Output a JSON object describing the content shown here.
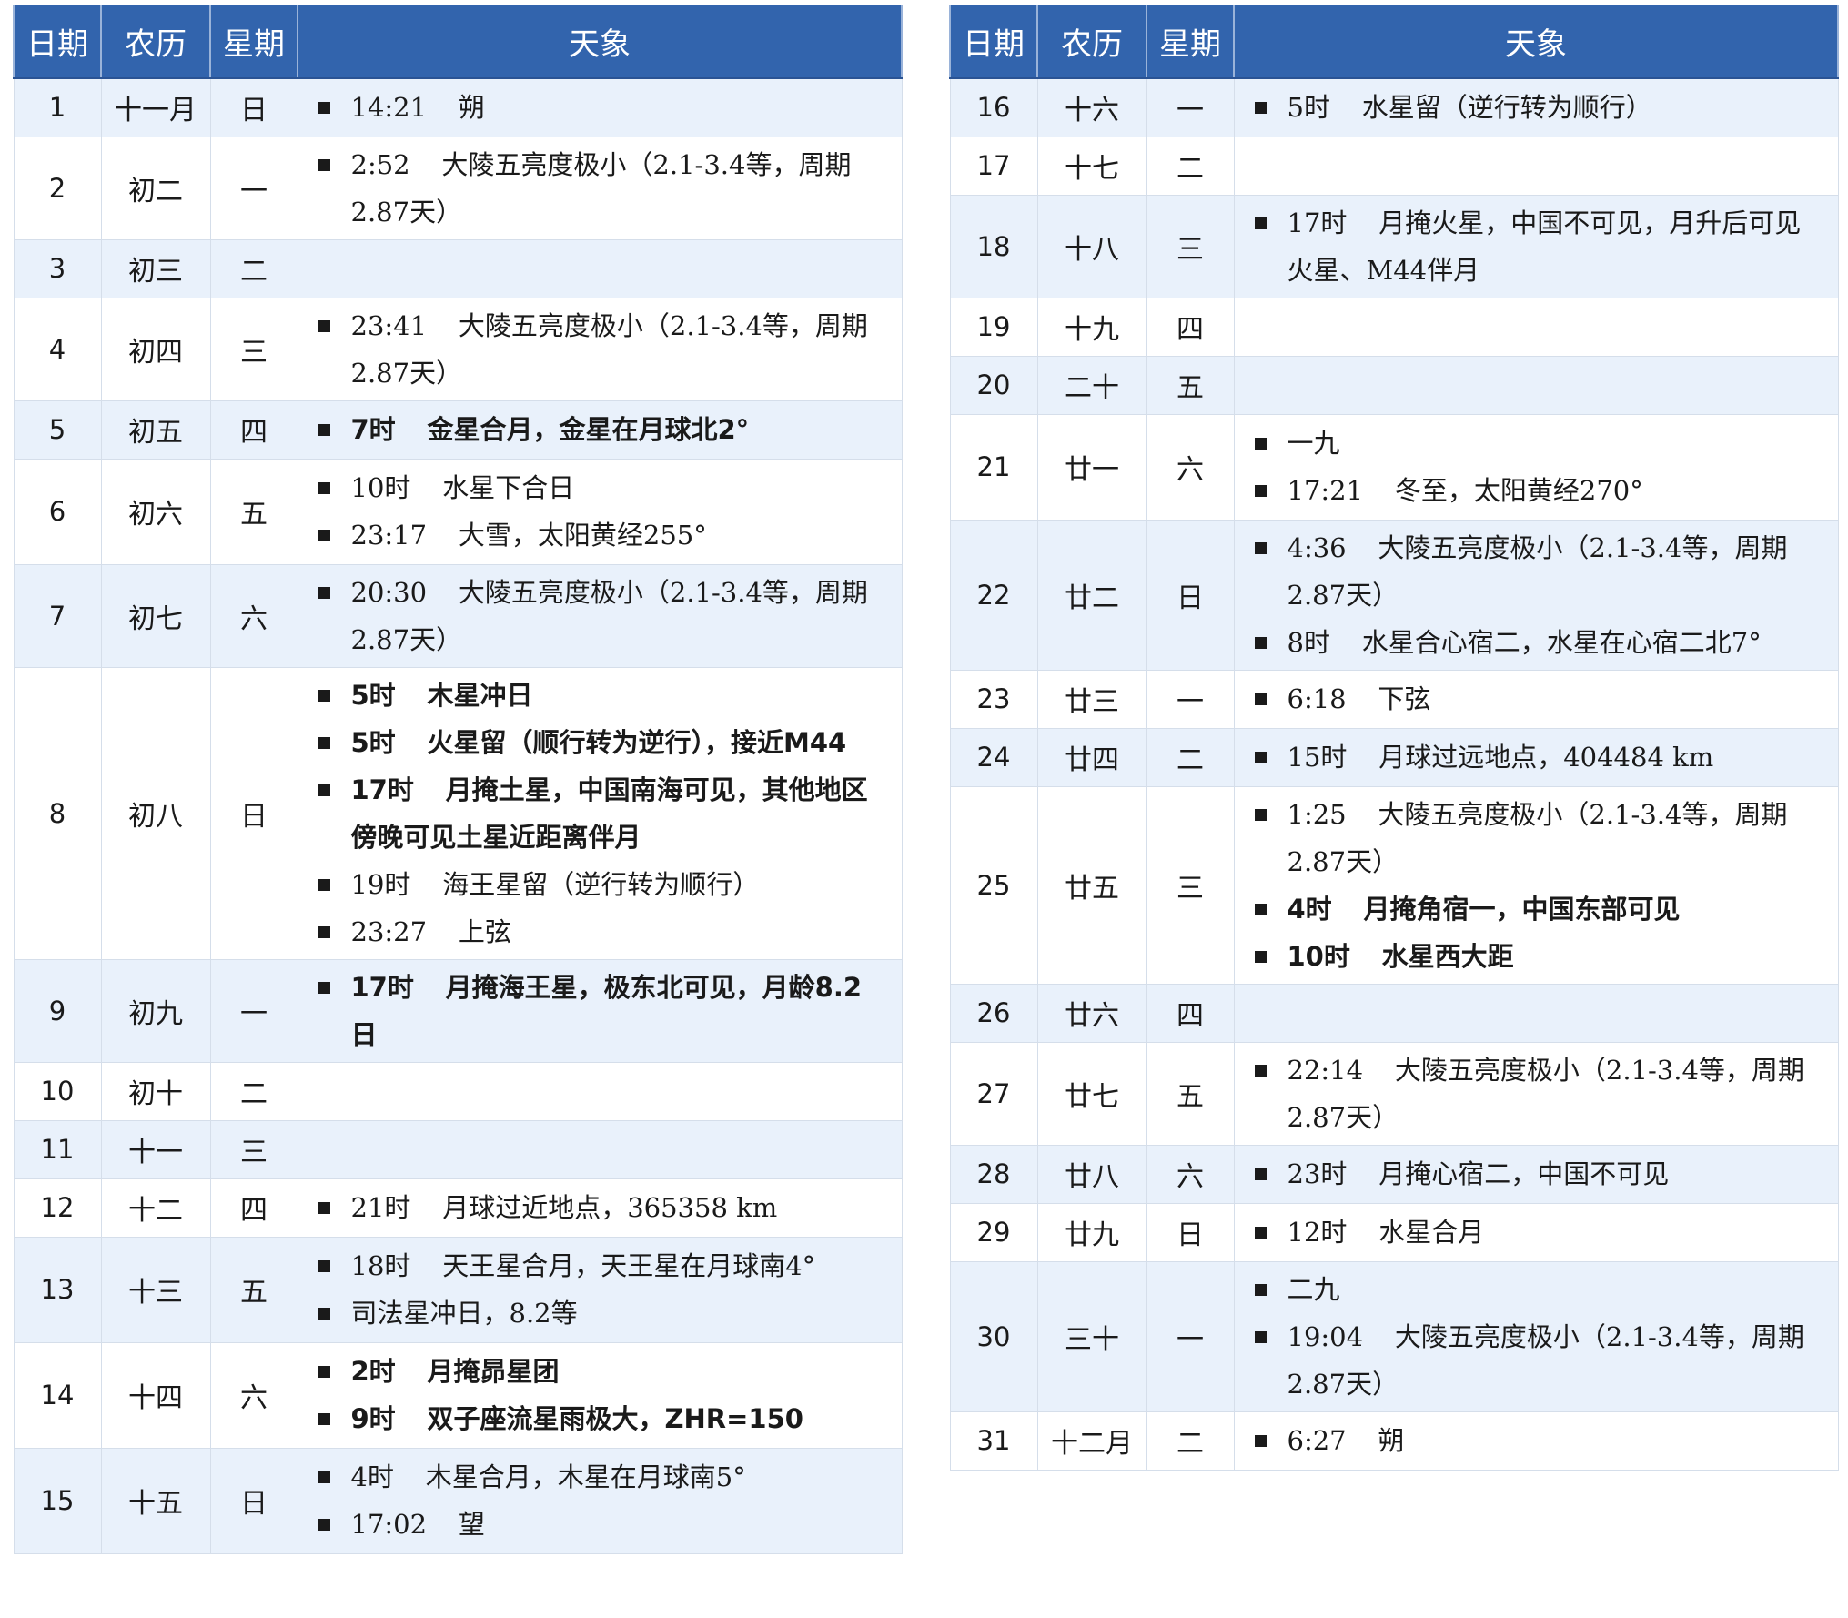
{
  "headers": [
    "日期",
    "农历",
    "星期",
    "天象"
  ],
  "left_rows": [
    {
      "date": "1",
      "lunar": "十一月",
      "weekday": "日",
      "events": [
        {
          "time": "14:21",
          "text": "朔"
        }
      ]
    },
    {
      "date": "2",
      "lunar": "初二",
      "weekday": "一",
      "events": [
        {
          "time": "2:52",
          "text": "大陵五亮度极小（2.1-3.4等，周期2.87天）"
        }
      ]
    },
    {
      "date": "3",
      "lunar": "初三",
      "weekday": "二",
      "events": []
    },
    {
      "date": "4",
      "lunar": "初四",
      "weekday": "三",
      "events": [
        {
          "time": "23:41",
          "text": "大陵五亮度极小（2.1-3.4等，周期2.87天）"
        }
      ]
    },
    {
      "date": "5",
      "lunar": "初五",
      "weekday": "四",
      "events": [
        {
          "time": "7时",
          "text": "金星合月，金星在月球北2°",
          "bold": true
        }
      ]
    },
    {
      "date": "6",
      "lunar": "初六",
      "weekday": "五",
      "events": [
        {
          "time": "10时",
          "text": "水星下合日"
        },
        {
          "time": "23:17",
          "text": "大雪，太阳黄经255°"
        }
      ]
    },
    {
      "date": "7",
      "lunar": "初七",
      "weekday": "六",
      "events": [
        {
          "time": "20:30",
          "text": "大陵五亮度极小（2.1-3.4等，周期2.87天）"
        }
      ]
    },
    {
      "date": "8",
      "lunar": "初八",
      "weekday": "日",
      "events": [
        {
          "time": "5时",
          "text": "木星冲日",
          "bold": true
        },
        {
          "time": "5时",
          "text": "火星留（顺行转为逆行），接近M44",
          "bold": true
        },
        {
          "time": "17时",
          "text": "月掩土星，中国南海可见，其他地区傍晚可见土星近距离伴月",
          "bold": true
        },
        {
          "time": "19时",
          "text": "海王星留（逆行转为顺行）"
        },
        {
          "time": "23:27",
          "text": "上弦"
        }
      ]
    },
    {
      "date": "9",
      "lunar": "初九",
      "weekday": "一",
      "events": [
        {
          "time": "17时",
          "text": "月掩海王星，极东北可见，月龄8.2日",
          "bold": true
        }
      ]
    },
    {
      "date": "10",
      "lunar": "初十",
      "weekday": "二",
      "events": []
    },
    {
      "date": "11",
      "lunar": "十一",
      "weekday": "三",
      "events": []
    },
    {
      "date": "12",
      "lunar": "十二",
      "weekday": "四",
      "events": [
        {
          "time": "21时",
          "text": "月球过近地点，365358 km"
        }
      ]
    },
    {
      "date": "13",
      "lunar": "十三",
      "weekday": "五",
      "events": [
        {
          "time": "18时",
          "text": "天王星合月，天王星在月球南4°"
        },
        {
          "time": "",
          "text": "司法星冲日，8.2等"
        }
      ]
    },
    {
      "date": "14",
      "lunar": "十四",
      "weekday": "六",
      "events": [
        {
          "time": "2时",
          "text": "月掩昴星团",
          "bold": true
        },
        {
          "time": "9时",
          "text": "双子座流星雨极大，ZHR=150",
          "bold": true
        }
      ]
    },
    {
      "date": "15",
      "lunar": "十五",
      "weekday": "日",
      "events": [
        {
          "time": "4时",
          "text": "木星合月，木星在月球南5°"
        },
        {
          "time": "17:02",
          "text": "望"
        }
      ]
    }
  ],
  "right_rows": [
    {
      "date": "16",
      "lunar": "十六",
      "weekday": "一",
      "events": [
        {
          "time": "5时",
          "text": "水星留（逆行转为顺行）"
        }
      ]
    },
    {
      "date": "17",
      "lunar": "十七",
      "weekday": "二",
      "events": []
    },
    {
      "date": "18",
      "lunar": "十八",
      "weekday": "三",
      "events": [
        {
          "time": "17时",
          "text": "月掩火星，中国不可见，月升后可见火星、M44伴月"
        }
      ]
    },
    {
      "date": "19",
      "lunar": "十九",
      "weekday": "四",
      "events": []
    },
    {
      "date": "20",
      "lunar": "二十",
      "weekday": "五",
      "events": []
    },
    {
      "date": "21",
      "lunar": "廿一",
      "weekday": "六",
      "events": [
        {
          "time": "",
          "text": "一九"
        },
        {
          "time": "17:21",
          "text": "冬至，太阳黄经270°"
        }
      ]
    },
    {
      "date": "22",
      "lunar": "廿二",
      "weekday": "日",
      "events": [
        {
          "time": "4:36",
          "text": "大陵五亮度极小（2.1-3.4等，周期2.87天）"
        },
        {
          "time": "8时",
          "text": "水星合心宿二，水星在心宿二北7°"
        }
      ]
    },
    {
      "date": "23",
      "lunar": "廿三",
      "weekday": "一",
      "events": [
        {
          "time": "6:18",
          "text": "下弦"
        }
      ]
    },
    {
      "date": "24",
      "lunar": "廿四",
      "weekday": "二",
      "events": [
        {
          "time": "15时",
          "text": "月球过远地点，404484 km"
        }
      ]
    },
    {
      "date": "25",
      "lunar": "廿五",
      "weekday": "三",
      "events": [
        {
          "time": "1:25",
          "text": "大陵五亮度极小（2.1-3.4等，周期2.87天）"
        },
        {
          "time": "4时",
          "text": "月掩角宿一，中国东部可见",
          "bold": true
        },
        {
          "time": "10时",
          "text": "水星西大距",
          "bold": true
        }
      ]
    },
    {
      "date": "26",
      "lunar": "廿六",
      "weekday": "四",
      "events": []
    },
    {
      "date": "27",
      "lunar": "廿七",
      "weekday": "五",
      "events": [
        {
          "time": "22:14",
          "text": "大陵五亮度极小（2.1-3.4等，周期2.87天）"
        }
      ]
    },
    {
      "date": "28",
      "lunar": "廿八",
      "weekday": "六",
      "events": [
        {
          "time": "23时",
          "text": "月掩心宿二，中国不可见"
        }
      ]
    },
    {
      "date": "29",
      "lunar": "廿九",
      "weekday": "日",
      "events": [
        {
          "time": "12时",
          "text": "水星合月"
        }
      ]
    },
    {
      "date": "30",
      "lunar": "三十",
      "weekday": "一",
      "events": [
        {
          "time": "",
          "text": "二九"
        },
        {
          "time": "19:04",
          "text": "大陵五亮度极小（2.1-3.4等，周期2.87天）"
        }
      ]
    },
    {
      "date": "31",
      "lunar": "十二月",
      "weekday": "二",
      "events": [
        {
          "time": "6:27",
          "text": "朔"
        }
      ]
    }
  ]
}
